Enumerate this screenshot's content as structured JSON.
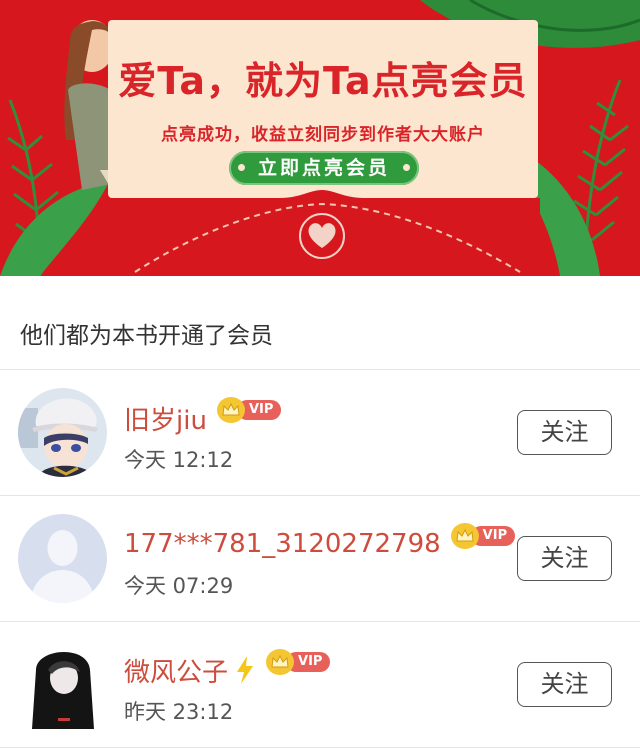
{
  "banner": {
    "title": "爱Ta，就为Ta点亮会员",
    "subtitle": "点亮成功，收益立刻同步到作者大大账户",
    "cta_label": "立即点亮会员",
    "colors": {
      "background": "#d6181e",
      "card": "#fde6cf",
      "cta": "#2f9b3c",
      "title": "#d9252a"
    }
  },
  "section": {
    "title": "他们都为本书开通了会员"
  },
  "members": [
    {
      "name": "旧岁jiu",
      "vip_label": "VIP",
      "time": "今天 12:12",
      "follow_label": "关注",
      "avatar": "anime-boy-avatar",
      "badge_icon": ""
    },
    {
      "name": "177***781_3120272798",
      "vip_label": "VIP",
      "time": "今天 07:29",
      "follow_label": "关注",
      "avatar": "default-user-avatar",
      "badge_icon": ""
    },
    {
      "name": "微风公子",
      "vip_label": "VIP",
      "time": "昨天 23:12",
      "follow_label": "关注",
      "avatar": "dark-hoodie-avatar",
      "badge_icon": "lightning-icon"
    }
  ],
  "colors": {
    "name": "#cd4c3c",
    "vip_tag": "#e8605a",
    "crown": "#f4c631"
  }
}
